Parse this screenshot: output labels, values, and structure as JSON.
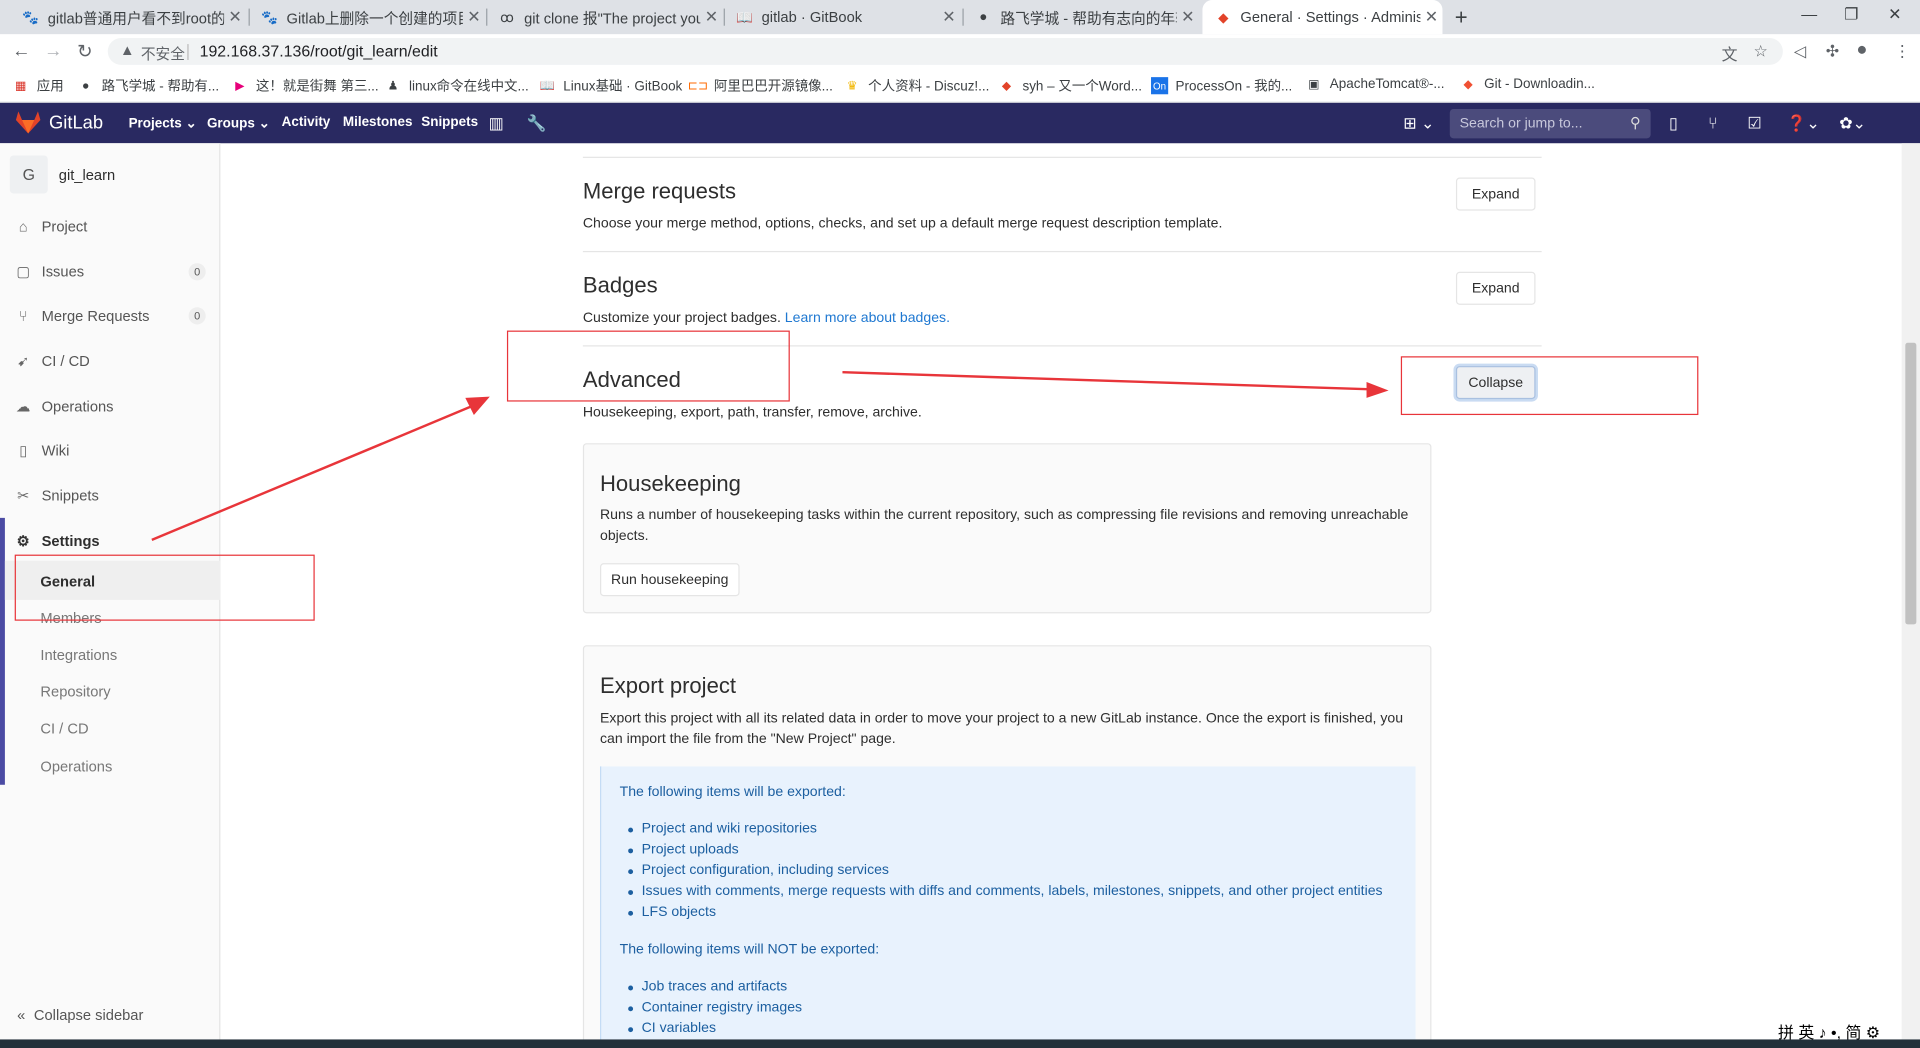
{
  "browser": {
    "tabs": [
      {
        "title": "gitlab普通用户看不到root的代码",
        "icon": "baidu-icon"
      },
      {
        "title": "Gitlab上删除一个创建的项目-百度",
        "icon": "baidu-icon"
      },
      {
        "title": "git clone 报\"The project you w",
        "icon": "git-icon"
      },
      {
        "title": "gitlab · GitBook",
        "icon": "book-icon"
      },
      {
        "title": "路飞学城 - 帮助有志向的年轻人",
        "icon": "luffy-icon"
      },
      {
        "title": "General · Settings · Administra",
        "icon": "gitlab-icon"
      }
    ],
    "security_label": "不安全",
    "url": "192.168.37.136/root/git_learn/edit",
    "bookmarks": [
      "应用",
      "路飞学城 - 帮助有...",
      "这！就是街舞 第三...",
      "linux命令在线中文...",
      "Linux基础 · GitBook",
      "阿里巴巴开源镜像...",
      "个人资料 - Discuz!...",
      "syh – 又一个Word...",
      "ProcessOn - 我的...",
      "ApacheTomcat®-...",
      "Git - Downloadin..."
    ]
  },
  "header": {
    "brand": "GitLab",
    "nav": [
      "Projects",
      "Groups",
      "Activity",
      "Milestones",
      "Snippets"
    ],
    "search_placeholder": "Search or jump to..."
  },
  "sidebar": {
    "avatar_letter": "G",
    "project_name": "git_learn",
    "items": [
      {
        "label": "Project"
      },
      {
        "label": "Issues",
        "count": "0"
      },
      {
        "label": "Merge Requests",
        "count": "0"
      },
      {
        "label": "CI / CD"
      },
      {
        "label": "Operations"
      },
      {
        "label": "Wiki"
      },
      {
        "label": "Snippets"
      },
      {
        "label": "Settings"
      }
    ],
    "settings_sub": [
      "General",
      "Members",
      "Integrations",
      "Repository",
      "CI / CD",
      "Operations"
    ],
    "collapse_label": "Collapse sidebar"
  },
  "main": {
    "merge": {
      "title": "Merge requests",
      "desc": "Choose your merge method, options, checks, and set up a default merge request description template.",
      "button": "Expand"
    },
    "badges": {
      "title": "Badges",
      "desc": "Customize your project badges.",
      "link": "Learn more about badges.",
      "button": "Expand"
    },
    "advanced": {
      "title": "Advanced",
      "desc": "Housekeeping, export, path, transfer, remove, archive.",
      "button": "Collapse"
    },
    "housekeeping": {
      "title": "Housekeeping",
      "desc": "Runs a number of housekeeping tasks within the current repository, such as compressing file revisions and removing unreachable objects.",
      "button": "Run housekeeping"
    },
    "export": {
      "title": "Export project",
      "desc": "Export this project with all its related data in order to move your project to a new GitLab instance. Once the export is finished, you can import the file from the \"New Project\" page.",
      "exported_heading": "The following items will be exported:",
      "exported": [
        "Project and wiki repositories",
        "Project uploads",
        "Project configuration, including services",
        "Issues with comments, merge requests with diffs and comments, labels, milestones, snippets, and other project entities",
        "LFS objects"
      ],
      "not_exported_heading": "The following items will NOT be exported:",
      "not_exported": [
        "Job traces and artifacts",
        "Container registry images",
        "CI variables"
      ]
    }
  },
  "ime": "拼 英 ♪ •, 简 ⚙",
  "annotation_color": "#e8353a"
}
